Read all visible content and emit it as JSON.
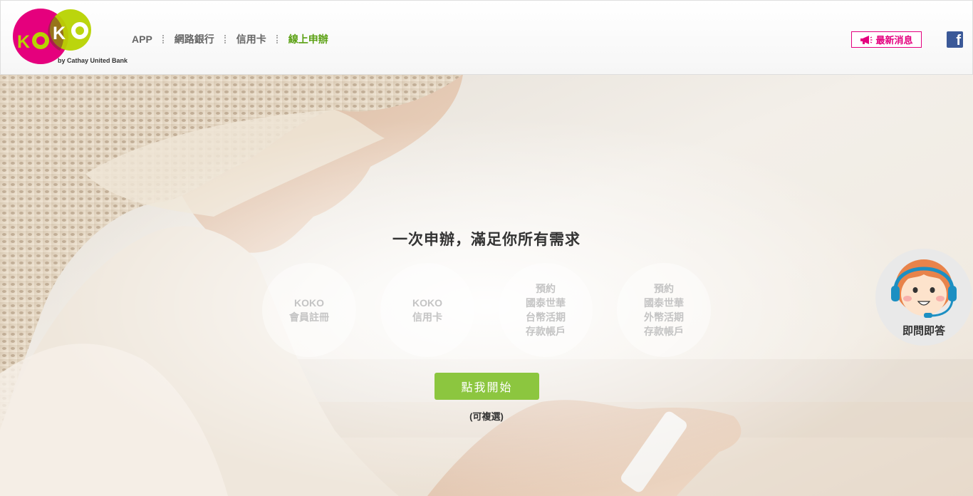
{
  "brand": {
    "logo_text": "KOKO",
    "tagline": "by Cathay United Bank",
    "colors": {
      "pink": "#e4007f",
      "lime": "#b6d300",
      "green": "#5aa012"
    }
  },
  "nav": {
    "items": [
      {
        "label": "APP",
        "active": false
      },
      {
        "label": "網路銀行",
        "active": false
      },
      {
        "label": "信用卡",
        "active": false
      },
      {
        "label": "線上申辦",
        "active": true
      }
    ]
  },
  "header": {
    "news_label": "最新消息",
    "news_icon": "megaphone-icon",
    "facebook_icon": "facebook-icon"
  },
  "hero": {
    "title": "一次申辦，滿足你所有需求",
    "options": [
      {
        "lines": [
          "KOKO",
          "會員註冊"
        ]
      },
      {
        "lines": [
          "KOKO",
          "信用卡"
        ]
      },
      {
        "lines": [
          "預約",
          "國泰世華",
          "台幣活期",
          "存款帳戶"
        ]
      },
      {
        "lines": [
          "預約",
          "國泰世華",
          "外幣活期",
          "存款帳戶"
        ]
      }
    ],
    "start_button": "點我開始",
    "note": "(可複選)"
  },
  "chat": {
    "label": "即問即答",
    "icon": "customer-service-avatar-icon"
  }
}
